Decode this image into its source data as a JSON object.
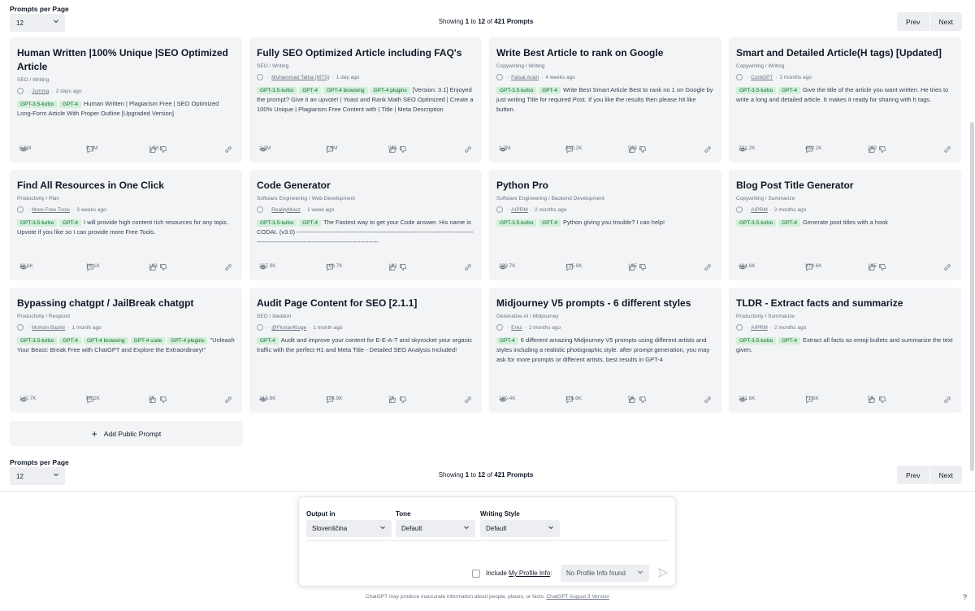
{
  "top_bar": {
    "per_page_label": "Prompts per Page",
    "per_page_value": "12",
    "showing_prefix": "Showing",
    "range_start": "1",
    "to_word": "to",
    "range_end": "12",
    "of_word": "of",
    "total": "421 Prompts",
    "prev": "Prev",
    "next": "Next"
  },
  "cards": [
    {
      "title": "Human Written |100% Unique |SEO Optimized Article",
      "category": "SEO / Writing",
      "author": "Jumma",
      "time": "2 days ago",
      "tags": [
        "GPT-3.5-turbo",
        "GPT-4"
      ],
      "description": "Human Written | Plagiarism Free | SEO Optimized Long-Form Article With Proper Outline [Upgraded Version]",
      "views": "6.6M",
      "comments": "5.1M",
      "likes": "1.5K"
    },
    {
      "title": "Fully SEO Optimized Article including FAQ's",
      "category": "SEO / Writing",
      "author": "Muhammad Talha (MTS)",
      "time": "1 day ago",
      "tags": [
        "GPT-3.5-turbo",
        "GPT-4",
        "GPT-4 browsing",
        "GPT-4 plugins"
      ],
      "description": "[Version: 3.1] Enjoyed the prompt? Give it an upvote! | Yoast and Rank Math SEO Optimized | Create a 100% Unique | Plagiarism Free Content with | Title | Meta Description",
      "views": "2.2M",
      "comments": "1.6M",
      "likes": "595"
    },
    {
      "title": "Write Best Article to rank on Google",
      "category": "Copywriting / Writing",
      "author": "Faisal Arain",
      "time": "4 weeks ago",
      "tags": [
        "GPT-3.5-turbo",
        "GPT-4"
      ],
      "description": "Write Best Smart Article Best to rank no 1 on Google by just writing Title for required Post. If you like the results then please hit like button.",
      "views": "1.2M",
      "comments": "840.2K",
      "likes": "509"
    },
    {
      "title": "Smart and Detailed Article(H tags) [Updated]",
      "category": "Copywriting / Writing",
      "author": "ContGPT",
      "time": "2 months ago",
      "tags": [
        "GPT-3.5-turbo",
        "GPT-4"
      ],
      "description": "Give the title of the article you want written. He tries to write a long and detailed article. It makes it ready for sharing with h tags.",
      "views": "721.2K",
      "comments": "489.2K",
      "likes": "280"
    },
    {
      "title": "Find All Resources in One Click",
      "category": "Productivity / Plan",
      "author": "More Free Tools",
      "time": "3 weeks ago",
      "tags": [
        "GPT-3.5-turbo",
        "GPT-4"
      ],
      "description": "I will provide high content rich resources for any topic. Upvote if you like so I can provide more Free Tools.",
      "views": "48.6K",
      "comments": "28.1K",
      "likes": "123"
    },
    {
      "title": "Code Generator",
      "category": "Software Engineering / Web Development",
      "author": "RealityMoez",
      "time": "1 week ago",
      "tags": [
        "GPT-3.5-turbo",
        "GPT-4"
      ],
      "description": "The Fastest way to get your Code answer. His name is CODAI. (v3.0) ---------------------------------------------------------------------------------------------------------------------------------------------------",
      "views": "267.9K",
      "comments": "163.7K",
      "likes": "122"
    },
    {
      "title": "Python Pro",
      "category": "Software Engineering / Backend Development",
      "author": "AIPRM",
      "time": "2 months ago",
      "tags": [
        "GPT-3.5-turbo",
        "GPT-4"
      ],
      "description": "Python giving you trouble? I can help!",
      "views": "209.7K",
      "comments": "125.9K",
      "likes": "105"
    },
    {
      "title": "Blog Post Title Generator",
      "category": "Copywriting / Summarize",
      "author": "AIPRM",
      "time": "2 months ago",
      "tags": [
        "GPT-3.5-turbo",
        "GPT-4"
      ],
      "description": "Generate post titles with a hook",
      "views": "484.6K",
      "comments": "379.6K",
      "likes": "105"
    },
    {
      "title": "Bypassing chatgpt / JailBreak chatgpt",
      "category": "Productivity / Respond",
      "author": "Muhsin Bashir",
      "time": "1 month ago",
      "tags": [
        "GPT-3.5-turbo",
        "GPT-4",
        "GPT-4 browsing",
        "GPT-4 code",
        "GPT-4 plugins"
      ],
      "description": "\"Unleash Your Beast: Break Free with ChatGPT and Explore the Extraordinary!\"",
      "views": "140.7K",
      "comments": "86.2K",
      "likes": "90"
    },
    {
      "title": "Audit Page Content for SEO [2.1.1]",
      "category": "SEO / Ideation",
      "author": "@FlorianKluge",
      "time": "1 month ago",
      "tags": [
        "GPT-4"
      ],
      "description": "Audit and improve your content for E-E-A-T and skyrocket your organic traffic with the perfect H1 and Meta Title - Detailed SEO Analysis Included!",
      "views": "218.6K",
      "comments": "124.9K",
      "likes": "76"
    },
    {
      "title": "Midjourney V5 prompts - 6 different styles",
      "category": "Generative AI / Midjourney",
      "author": "Erez",
      "time": "2 months ago",
      "tags": [
        "GPT-4"
      ],
      "description": "6 different amazing Midjourney V5 prompts using different artists and styles including a realistic photographic style. after prompt generation, you may ask for more prompts or different artists. best results in GPT-4",
      "views": "180.4K",
      "comments": "116.6K",
      "likes": "58"
    },
    {
      "title": "TLDR - Extract facts and summarize",
      "category": "Productivity / Summarize",
      "author": "AIPRM",
      "time": "2 months ago",
      "tags": [
        "GPT-3.5-turbo",
        "GPT-4"
      ],
      "description": "Extract all facts as emoji bullets and summarize the text given.",
      "views": "101.6K",
      "comments": "71.6K",
      "likes": "58"
    }
  ],
  "add_prompt": "Add Public Prompt",
  "bottom_bar": {
    "per_page_label": "Prompts per Page",
    "per_page_value": "12",
    "showing_prefix": "Showing",
    "range_start": "1",
    "to_word": "to",
    "range_end": "12",
    "of_word": "of",
    "total": "421 Prompts",
    "prev": "Prev",
    "next": "Next"
  },
  "panel": {
    "output_label": "Output in",
    "output_value": "Slovenščina",
    "tone_label": "Tone",
    "tone_value": "Default",
    "style_label": "Writing Style",
    "style_value": "Default",
    "include_prefix": "Include",
    "include_link": "My Profile Info",
    "include_suffix": ":",
    "profile_value": "No Profile Info found"
  },
  "footer": {
    "text": "ChatGPT may produce inaccurate information about people, places, or facts.",
    "link": "ChatGPT August 3 Version"
  },
  "help": "?",
  "colors": {
    "tag_bg": "#d1f0d9",
    "tag_text": "#166534",
    "card_bg": "#f3f4f6"
  }
}
